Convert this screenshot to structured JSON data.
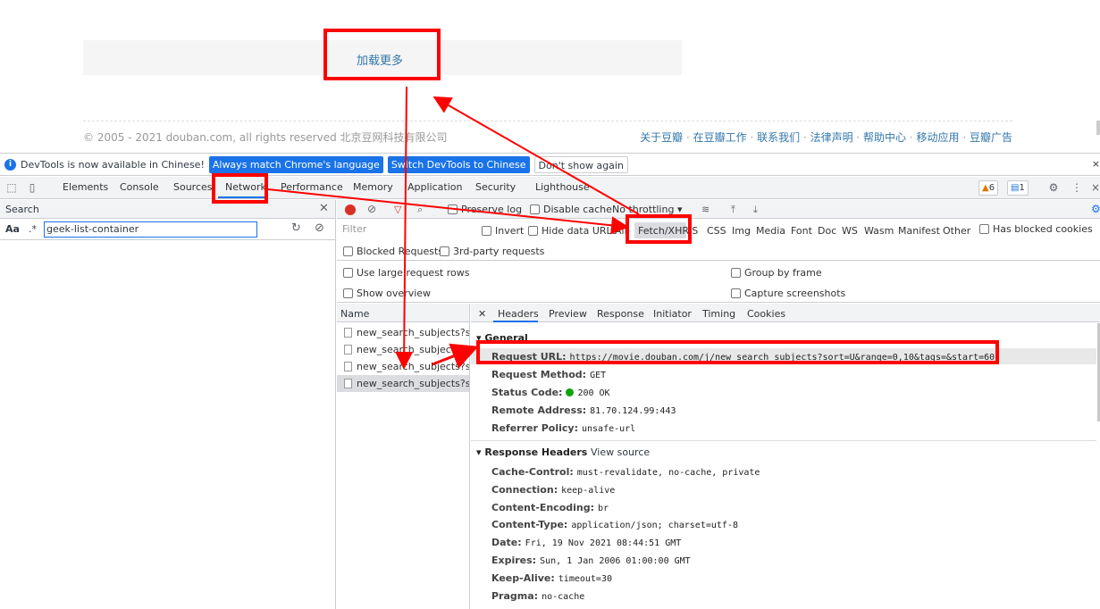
{
  "page": {
    "load_more": "加载更多",
    "copyright": "© 2005 - 2021 douban.com, all rights reserved 北京豆网科技有限公司",
    "footer_links": [
      "关于豆瓣",
      "在豆瓣工作",
      "联系我们",
      "法律声明",
      "帮助中心",
      "移动应用",
      "豆瓣广告"
    ]
  },
  "infobar": {
    "text": "DevTools is now available in Chinese!",
    "btn_match": "Always match Chrome's language",
    "btn_switch": "Switch DevTools to Chinese",
    "btn_dismiss": "Don't show again",
    "close": "×"
  },
  "tabs": [
    "Elements",
    "Console",
    "Sources",
    "Network",
    "Performance",
    "Memory",
    "Application",
    "Security",
    "Lighthouse"
  ],
  "badges": {
    "warnings": "6",
    "messages": "1"
  },
  "search": {
    "title": "Search",
    "aa": "Aa",
    "regex": ".*",
    "query": "geek-list-container"
  },
  "network": {
    "preserve_log": "Preserve log",
    "disable_cache": "Disable cache",
    "throttling": "No throttling",
    "filter_placeholder": "Filter",
    "invert": "Invert",
    "hide_data_urls": "Hide data URLs",
    "types": [
      "All",
      "Fetch/XHR",
      "JS",
      "CSS",
      "Img",
      "Media",
      "Font",
      "Doc",
      "WS",
      "Wasm",
      "Manifest",
      "Other"
    ],
    "has_blocked_cookies": "Has blocked cookies",
    "blocked_requests": "Blocked Requests",
    "third_party": "3rd-party requests",
    "large_rows": "Use large request rows",
    "show_overview": "Show overview",
    "group_by_frame": "Group by frame",
    "capture_screenshots": "Capture screenshots",
    "name_col": "Name",
    "requests": [
      "new_search_subjects?so...",
      "new_search_subjects?so...",
      "new_search_subjects?so...",
      "new_search_subjects?so..."
    ]
  },
  "details": {
    "tabs": [
      "Headers",
      "Preview",
      "Response",
      "Initiator",
      "Timing",
      "Cookies"
    ],
    "general_title": "General",
    "general": [
      {
        "k": "Request URL:",
        "v": "https://movie.douban.com/j/new_search_subjects?sort=U&range=0,10&tags=&start=60"
      },
      {
        "k": "Request Method:",
        "v": "GET"
      },
      {
        "k": "Status Code:",
        "v": "200 OK"
      },
      {
        "k": "Remote Address:",
        "v": "81.70.124.99:443"
      },
      {
        "k": "Referrer Policy:",
        "v": "unsafe-url"
      }
    ],
    "response_title": "Response Headers",
    "view_source": "View source",
    "response": [
      {
        "k": "Cache-Control:",
        "v": "must-revalidate, no-cache, private"
      },
      {
        "k": "Connection:",
        "v": "keep-alive"
      },
      {
        "k": "Content-Encoding:",
        "v": "br"
      },
      {
        "k": "Content-Type:",
        "v": "application/json; charset=utf-8"
      },
      {
        "k": "Date:",
        "v": "Fri, 19 Nov 2021 08:44:51 GMT"
      },
      {
        "k": "Expires:",
        "v": "Sun, 1 Jan 2006 01:00:00 GMT"
      },
      {
        "k": "Keep-Alive:",
        "v": "timeout=30"
      },
      {
        "k": "Pragma:",
        "v": "no-cache"
      }
    ]
  },
  "colors": {
    "annotation": "#ff0000",
    "accent": "#1a73e8",
    "link": "#3377aa"
  }
}
